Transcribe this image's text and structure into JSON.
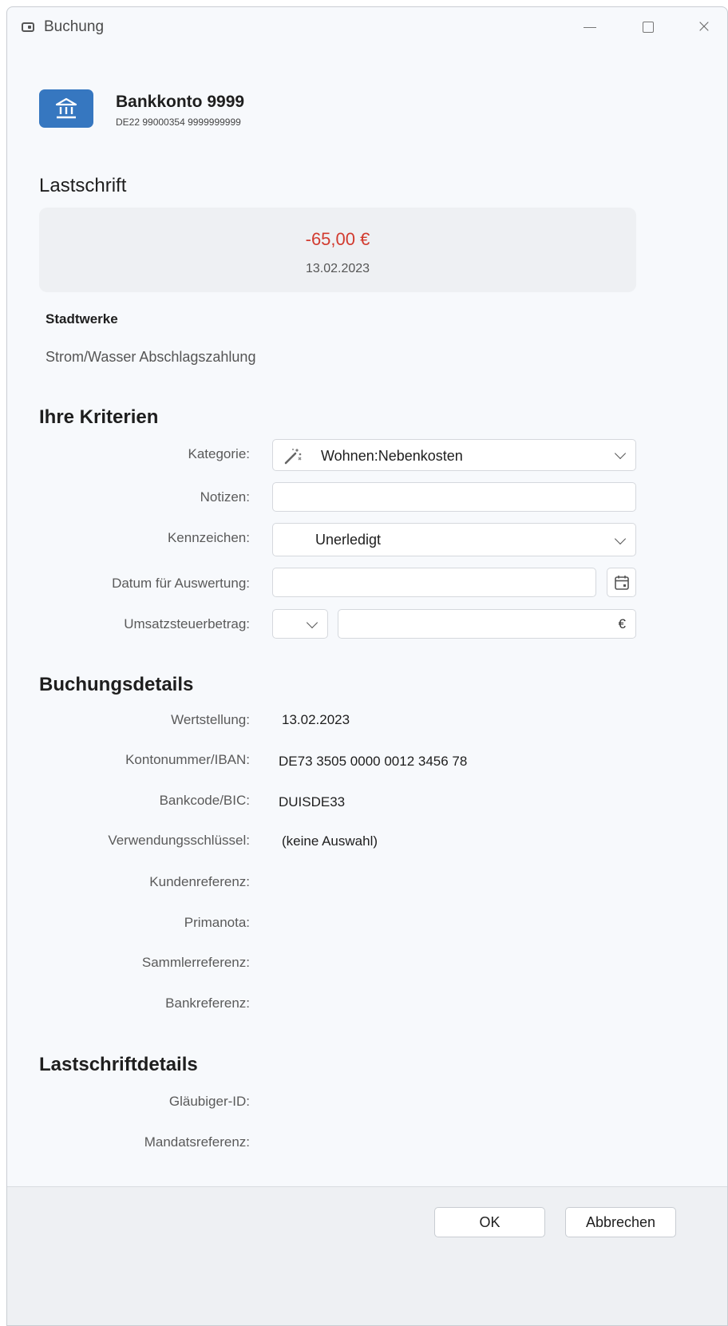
{
  "window": {
    "title": "Buchung",
    "icon": "window-icon",
    "controls": [
      "minimize-icon",
      "maximize-icon",
      "close-icon"
    ],
    "close_glyph": "×"
  },
  "account": {
    "icon": "bank-icon",
    "name": "Bankkonto 9999",
    "iban": "DE22 99000354 9999999999",
    "tile_color": "#3677c0"
  },
  "transaction": {
    "type_heading": "Lastschrift",
    "amount": "-65,00 €",
    "amount_color": "#d23b2f",
    "date": "13.02.2023",
    "payee": "Stadtwerke",
    "purpose": "Strom/Wasser Abschlagszahlung"
  },
  "criteria": {
    "heading": "Ihre Kriterien",
    "category": {
      "label": "Kategorie:",
      "value": "Wohnen:Nebenkosten",
      "icon": "magic-wand-icon"
    },
    "notes": {
      "label": "Notizen:",
      "value": ""
    },
    "flag": {
      "label": "Kennzeichen:",
      "value": "Unerledigt"
    },
    "eval_date": {
      "label": "Datum für Auswertung:",
      "value": "",
      "icon": "calendar-icon"
    },
    "vat": {
      "label": "Umsatzsteuerbetrag:",
      "rate": "",
      "amount": "",
      "currency": "€"
    }
  },
  "booking_details": {
    "heading": "Buchungsdetails",
    "rows": [
      {
        "label": "Wertstellung:",
        "value": "13.02.2023"
      },
      {
        "label": "Kontonummer/IBAN:",
        "value": "DE73 3505 0000 0012 3456 78"
      },
      {
        "label": "Bankcode/BIC:",
        "value": "DUISDE33"
      },
      {
        "label": "Verwendungsschlüssel:",
        "value": "(keine Auswahl)"
      },
      {
        "label": "Kundenreferenz:",
        "value": ""
      },
      {
        "label": "Primanota:",
        "value": ""
      },
      {
        "label": "Sammlerreferenz:",
        "value": ""
      },
      {
        "label": "Bankreferenz:",
        "value": ""
      }
    ]
  },
  "debit_details": {
    "heading": "Lastschriftdetails",
    "rows": [
      {
        "label": "Gläubiger-ID:",
        "value": ""
      },
      {
        "label": "Mandatsreferenz:",
        "value": ""
      }
    ]
  },
  "footer": {
    "ok_label": "OK",
    "cancel_label": "Abbrechen"
  }
}
